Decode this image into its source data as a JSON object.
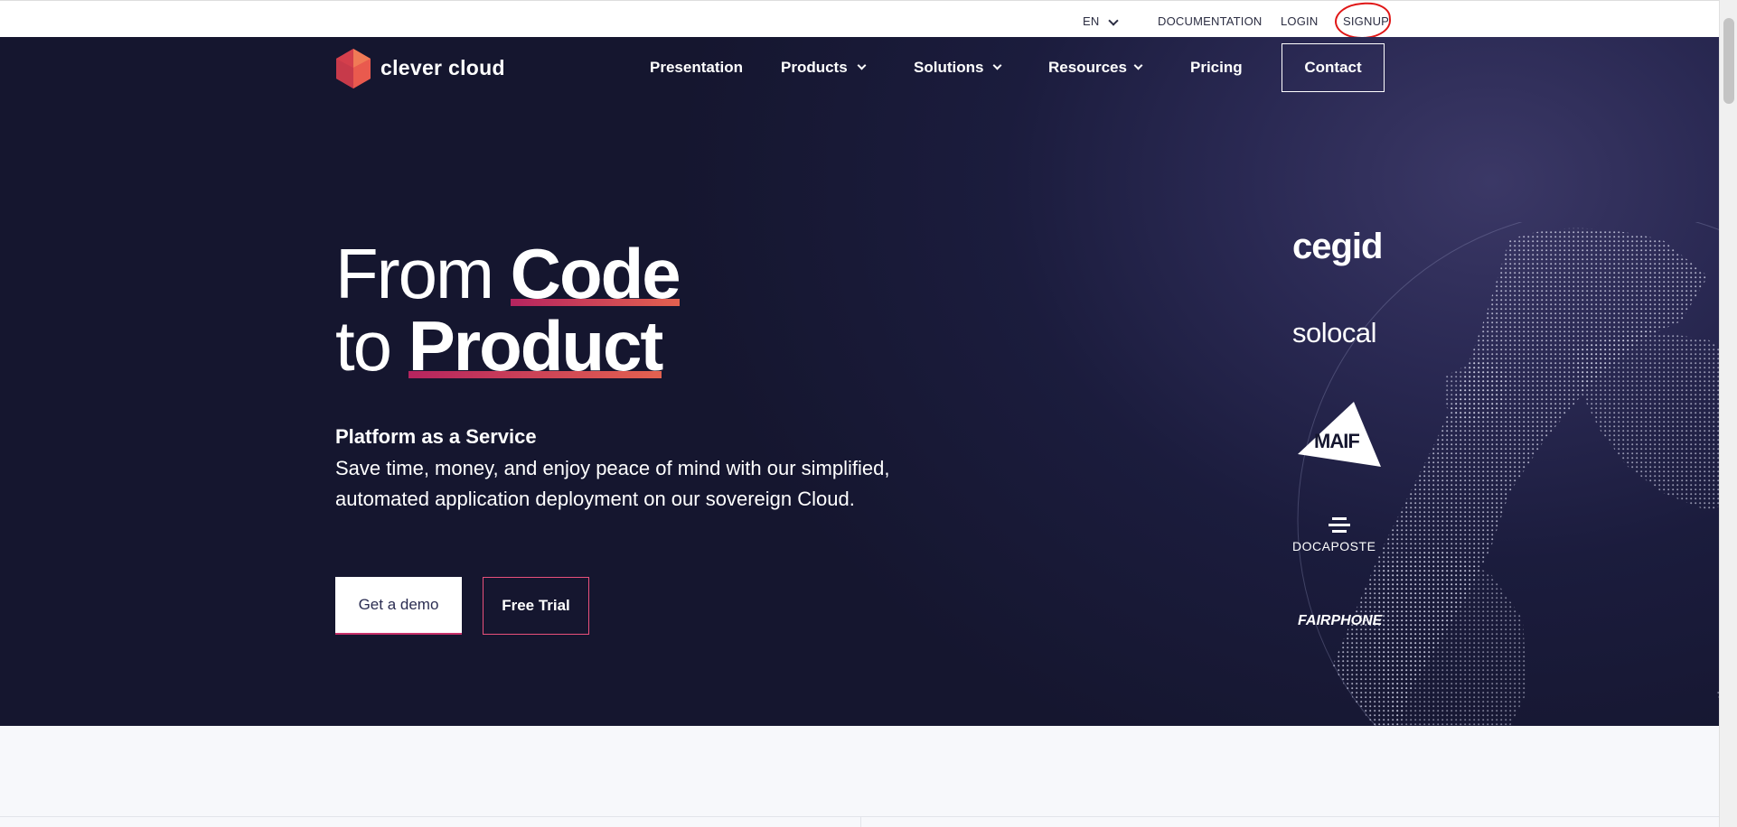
{
  "topbar": {
    "language": "EN",
    "documentation": "DOCUMENTATION",
    "login": "LOGIN",
    "signup": "SIGNUP"
  },
  "header": {
    "logo_text": "clever cloud",
    "nav": {
      "presentation": "Presentation",
      "products": "Products",
      "solutions": "Solutions",
      "resources": "Resources",
      "pricing": "Pricing"
    },
    "contact": "Contact"
  },
  "hero": {
    "line1_thin": "From",
    "line1_bold": "Code",
    "line2_thin": "to",
    "line2_bold": "Product",
    "subtitle": "Platform as a Service",
    "description": "Save time, money, and enjoy peace of mind with our simplified, automated application deployment on our sovereign Cloud.",
    "demo_button": "Get a demo",
    "trial_button": "Free Trial"
  },
  "clients": {
    "cegid": "cegid",
    "solocal": "solocal",
    "maif": "MAIF",
    "docaposte": "DOCAPOSTE",
    "fairphone": "FAIRPHONE"
  },
  "colors": {
    "hero_bg": "#15162f",
    "accent_gradient_start": "#b5245f",
    "accent_gradient_end": "#e3614f",
    "annotation_red": "#e01616"
  }
}
